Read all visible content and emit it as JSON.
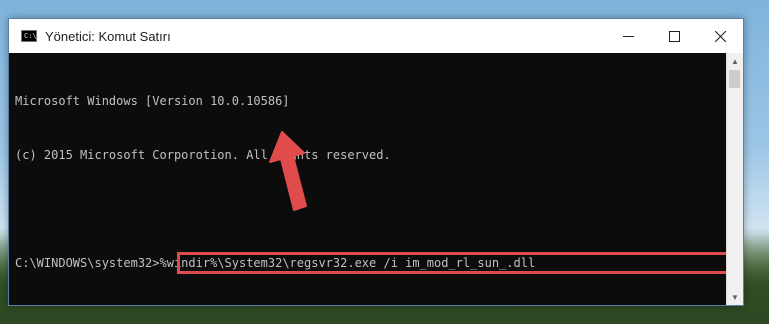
{
  "window": {
    "title": "Yönetici: Komut Satırı",
    "icon_text": "C:\\"
  },
  "controls": {
    "minimize_icon": "minimize-icon",
    "maximize_icon": "maximize-icon",
    "close_icon": "close-icon"
  },
  "console": {
    "line1": "Microsoft Windows [Version 10.0.10586]",
    "line2": "(c) 2015 Microsoft Corporotion. All rights reserved.",
    "prompt": "C:\\WINDOWS\\system32>",
    "command": "%windir%\\System32\\regsvr32.exe /i im_mod_rl_sun_.dll"
  },
  "colors": {
    "highlight": "#e04b4b",
    "console_bg": "#0c0c0c",
    "console_text": "#c0c0c0"
  }
}
